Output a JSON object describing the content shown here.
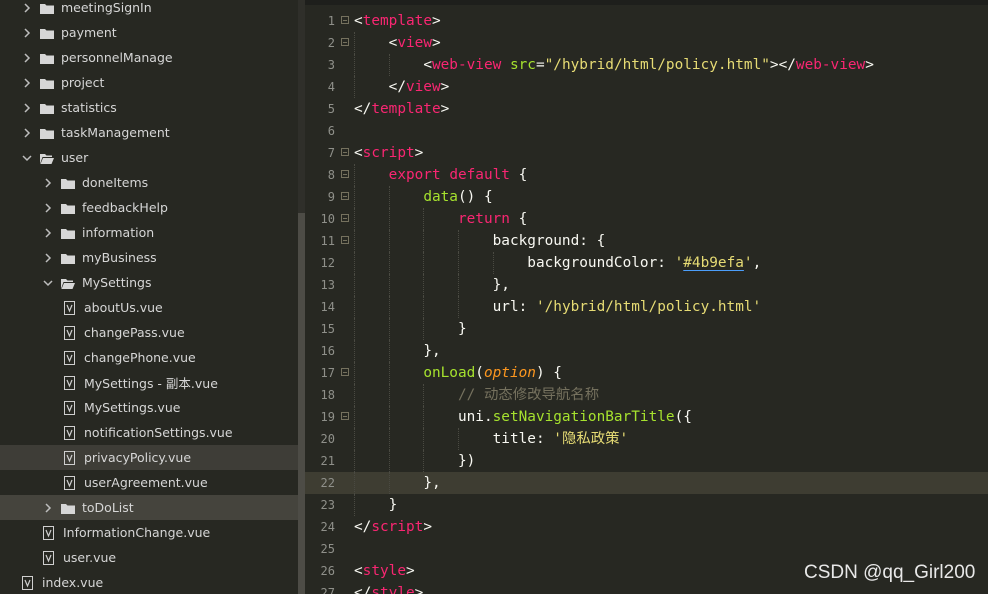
{
  "sidebar": {
    "rows": [
      {
        "label": "meetingSignIn",
        "type": "folder",
        "depth": 1,
        "expanded": false
      },
      {
        "label": "payment",
        "type": "folder",
        "depth": 1,
        "expanded": false
      },
      {
        "label": "personnelManage",
        "type": "folder",
        "depth": 1,
        "expanded": false
      },
      {
        "label": "project",
        "type": "folder",
        "depth": 1,
        "expanded": false
      },
      {
        "label": "statistics",
        "type": "folder",
        "depth": 1,
        "expanded": false
      },
      {
        "label": "taskManagement",
        "type": "folder",
        "depth": 1,
        "expanded": false
      },
      {
        "label": "user",
        "type": "folder",
        "depth": 1,
        "expanded": true
      },
      {
        "label": "doneItems",
        "type": "folder",
        "depth": 2,
        "expanded": false
      },
      {
        "label": "feedbackHelp",
        "type": "folder",
        "depth": 2,
        "expanded": false
      },
      {
        "label": "information",
        "type": "folder",
        "depth": 2,
        "expanded": false
      },
      {
        "label": "myBusiness",
        "type": "folder",
        "depth": 2,
        "expanded": false
      },
      {
        "label": "MySettings",
        "type": "folder",
        "depth": 2,
        "expanded": true
      },
      {
        "label": "aboutUs.vue",
        "type": "file",
        "depth": 3
      },
      {
        "label": "changePass.vue",
        "type": "file",
        "depth": 3
      },
      {
        "label": "changePhone.vue",
        "type": "file",
        "depth": 3
      },
      {
        "label": "MySettings - 副本.vue",
        "type": "file",
        "depth": 3
      },
      {
        "label": "MySettings.vue",
        "type": "file",
        "depth": 3
      },
      {
        "label": "notificationSettings.vue",
        "type": "file",
        "depth": 3
      },
      {
        "label": "privacyPolicy.vue",
        "type": "file",
        "depth": 3,
        "selected": true
      },
      {
        "label": "userAgreement.vue",
        "type": "file",
        "depth": 3
      },
      {
        "label": "toDoList",
        "type": "folder",
        "depth": 2,
        "expanded": false,
        "dirsel": true
      },
      {
        "label": "InformationChange.vue",
        "type": "file",
        "depth": 2
      },
      {
        "label": "user.vue",
        "type": "file",
        "depth": 2
      },
      {
        "label": "index.vue",
        "type": "file",
        "depth": 1
      }
    ]
  },
  "editor": {
    "lines": [
      {
        "n": "1",
        "fold": true,
        "indent": 0,
        "tokens": [
          [
            "t-punct",
            "<"
          ],
          [
            "t-tag",
            "template"
          ],
          [
            "t-punct",
            ">"
          ]
        ]
      },
      {
        "n": "2",
        "fold": true,
        "indent": 1,
        "tokens": [
          [
            "t-punct",
            "<"
          ],
          [
            "t-tag",
            "view"
          ],
          [
            "t-punct",
            ">"
          ]
        ]
      },
      {
        "n": "3",
        "fold": false,
        "indent": 2,
        "tokens": [
          [
            "t-punct",
            "<"
          ],
          [
            "t-tag",
            "web-view"
          ],
          [
            "t-punct",
            " "
          ],
          [
            "t-attr",
            "src"
          ],
          [
            "t-punct",
            "="
          ],
          [
            "t-str",
            "\"/hybrid/html/policy.html\""
          ],
          [
            "t-punct",
            "></"
          ],
          [
            "t-tag",
            "web-view"
          ],
          [
            "t-punct",
            ">"
          ]
        ]
      },
      {
        "n": "4",
        "fold": false,
        "indent": 1,
        "tokens": [
          [
            "t-punct",
            "</"
          ],
          [
            "t-tag",
            "view"
          ],
          [
            "t-punct",
            ">"
          ]
        ]
      },
      {
        "n": "5",
        "fold": false,
        "indent": 0,
        "tokens": [
          [
            "t-punct",
            "</"
          ],
          [
            "t-tag",
            "template"
          ],
          [
            "t-punct",
            ">"
          ]
        ]
      },
      {
        "n": "6",
        "fold": false,
        "indent": 0,
        "tokens": []
      },
      {
        "n": "7",
        "fold": true,
        "indent": 0,
        "tokens": [
          [
            "t-punct",
            "<"
          ],
          [
            "t-tag",
            "script"
          ],
          [
            "t-punct",
            ">"
          ]
        ]
      },
      {
        "n": "8",
        "fold": true,
        "indent": 1,
        "tokens": [
          [
            "t-kw",
            "export"
          ],
          [
            "t-punct",
            " "
          ],
          [
            "t-kw",
            "default"
          ],
          [
            "t-punct",
            " {"
          ]
        ]
      },
      {
        "n": "9",
        "fold": true,
        "indent": 2,
        "tokens": [
          [
            "t-fn",
            "data"
          ],
          [
            "t-punct",
            "() {"
          ]
        ]
      },
      {
        "n": "10",
        "fold": true,
        "indent": 3,
        "tokens": [
          [
            "t-kw",
            "return"
          ],
          [
            "t-punct",
            " {"
          ]
        ]
      },
      {
        "n": "11",
        "fold": true,
        "indent": 4,
        "tokens": [
          [
            "t-punct",
            "background: {"
          ]
        ]
      },
      {
        "n": "12",
        "fold": false,
        "indent": 5,
        "tokens": [
          [
            "t-punct",
            "backgroundColor: "
          ],
          [
            "t-str",
            "'"
          ],
          [
            "t-str underline-blue",
            "#4b9efa"
          ],
          [
            "t-str",
            "'"
          ],
          [
            "t-punct",
            ","
          ]
        ]
      },
      {
        "n": "13",
        "fold": false,
        "indent": 4,
        "tokens": [
          [
            "t-punct",
            "},"
          ]
        ]
      },
      {
        "n": "14",
        "fold": false,
        "indent": 4,
        "tokens": [
          [
            "t-punct",
            "url: "
          ],
          [
            "t-str",
            "'/hybrid/html/policy.html'"
          ]
        ]
      },
      {
        "n": "15",
        "fold": false,
        "indent": 3,
        "tokens": [
          [
            "t-punct",
            "}"
          ]
        ]
      },
      {
        "n": "16",
        "fold": false,
        "indent": 2,
        "tokens": [
          [
            "t-punct",
            "},"
          ]
        ]
      },
      {
        "n": "17",
        "fold": true,
        "indent": 2,
        "tokens": [
          [
            "t-fn",
            "onLoad"
          ],
          [
            "t-punct",
            "("
          ],
          [
            "t-param",
            "option"
          ],
          [
            "t-punct",
            ") {"
          ]
        ]
      },
      {
        "n": "18",
        "fold": false,
        "indent": 3,
        "tokens": [
          [
            "t-cmt",
            "// 动态修改导航名称"
          ]
        ]
      },
      {
        "n": "19",
        "fold": true,
        "indent": 3,
        "tokens": [
          [
            "t-punct",
            "uni."
          ],
          [
            "t-fn",
            "setNavigationBarTitle"
          ],
          [
            "t-punct",
            "({"
          ]
        ]
      },
      {
        "n": "20",
        "fold": false,
        "indent": 4,
        "tokens": [
          [
            "t-punct",
            "title: "
          ],
          [
            "t-str",
            "'隐私政策'"
          ]
        ]
      },
      {
        "n": "21",
        "fold": false,
        "indent": 3,
        "tokens": [
          [
            "t-punct",
            "})"
          ]
        ]
      },
      {
        "n": "22",
        "fold": false,
        "indent": 2,
        "current": true,
        "tokens": [
          [
            "t-punct",
            "},"
          ]
        ]
      },
      {
        "n": "23",
        "fold": false,
        "indent": 1,
        "tokens": [
          [
            "t-punct",
            "}"
          ]
        ]
      },
      {
        "n": "24",
        "fold": false,
        "indent": 0,
        "tokens": [
          [
            "t-punct",
            "</"
          ],
          [
            "t-tag",
            "script"
          ],
          [
            "t-punct",
            ">"
          ]
        ]
      },
      {
        "n": "25",
        "fold": false,
        "indent": 0,
        "tokens": []
      },
      {
        "n": "26",
        "fold": false,
        "indent": 0,
        "tokens": [
          [
            "t-punct",
            "<"
          ],
          [
            "t-tag",
            "style"
          ],
          [
            "t-punct",
            ">"
          ]
        ]
      },
      {
        "n": "27",
        "fold": false,
        "indent": 0,
        "tokens": [
          [
            "t-punct",
            "</"
          ],
          [
            "t-tag",
            "style"
          ],
          [
            "t-punct",
            ">"
          ]
        ]
      }
    ]
  },
  "watermark": "CSDN @qq_Girl200",
  "colors": {
    "folder": "#d6d6d6",
    "chevron": "#bdbdbd",
    "accent_underline": "#4b9efa"
  }
}
